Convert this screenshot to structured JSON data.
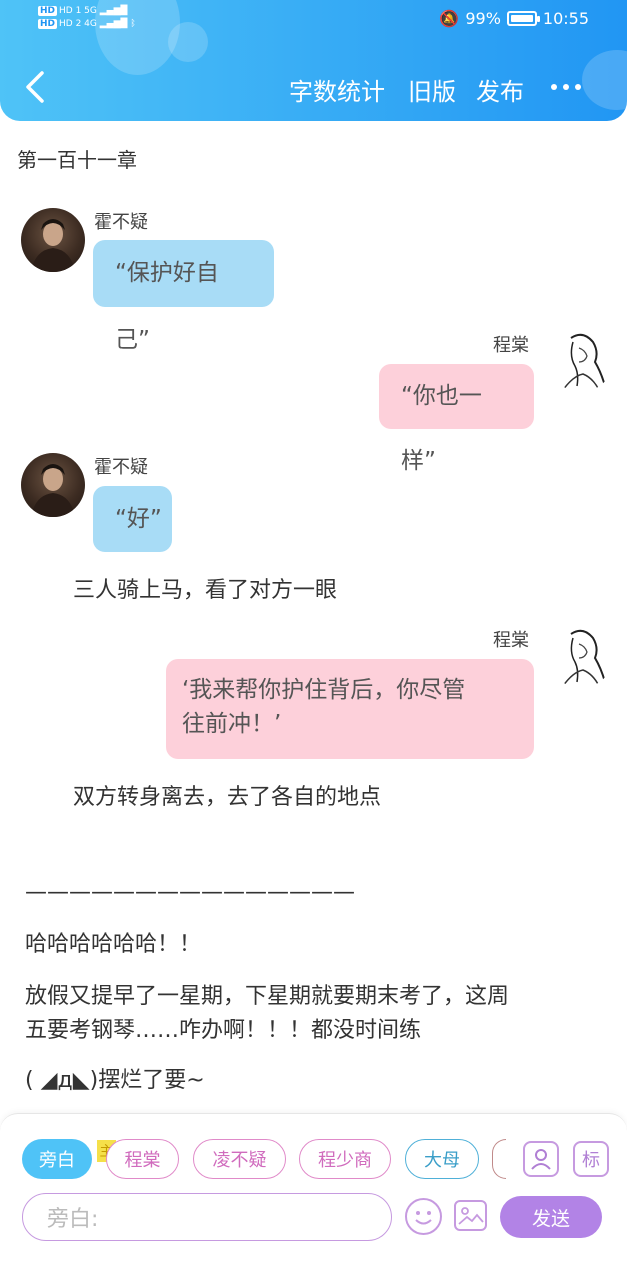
{
  "status": {
    "left_lines": [
      "HD 1 5G",
      "HD 2 4G"
    ],
    "battery_percent": "99%",
    "time": "10:55"
  },
  "header": {
    "nav": [
      "字数统计",
      "旧版",
      "发布"
    ]
  },
  "chapter_title": "第一百十一章",
  "messages": [
    {
      "speaker": "霍不疑",
      "text": "“保护好自己”"
    },
    {
      "speaker": "程棠",
      "text": "“你也一样”"
    },
    {
      "speaker": "霍不疑",
      "text": "“好”"
    },
    {
      "speaker": "程棠",
      "text_line1": "‘我来帮你护住背后，你尽管",
      "text_line2": "往前冲！’"
    }
  ],
  "narration": [
    "三人骑上马，看了对方一眼",
    "双方转身离去，去了各自的地点"
  ],
  "notes": {
    "divider": "———————————————",
    "line1": "哈哈哈哈哈哈！！",
    "line2a": "放假又提早了一星期，下星期就要期末考了，这周",
    "line2b": "五要考钢琴……咋办啊！！！都没时间练",
    "line3": "( ◢д◣)摆烂了要~"
  },
  "composer": {
    "roles": [
      "旁白",
      "程棠",
      "凌不疑",
      "程少商",
      "大母"
    ],
    "main_tag": "主",
    "tag_button": "标",
    "input_placeholder": "旁白:",
    "send_label": "发送"
  }
}
